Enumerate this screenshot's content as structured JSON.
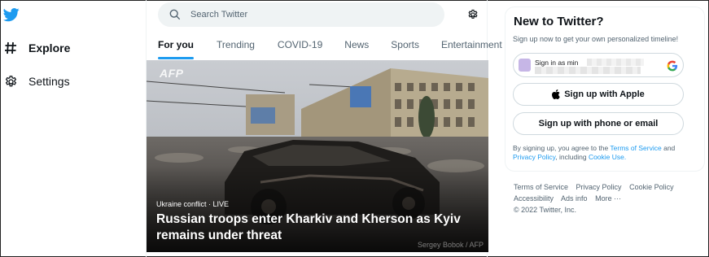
{
  "colors": {
    "brand": "#1d9bf0",
    "text": "#0f1419",
    "muted": "#536471"
  },
  "nav": {
    "logo_icon": "twitter-bird-icon",
    "items": [
      {
        "label": "Explore",
        "icon": "hashtag-icon"
      },
      {
        "label": "Settings",
        "icon": "gear-icon"
      }
    ]
  },
  "search": {
    "placeholder": "Search Twitter",
    "value": ""
  },
  "tabs": [
    "For you",
    "Trending",
    "COVID-19",
    "News",
    "Sports",
    "Entertainment"
  ],
  "hero": {
    "watermark": "AFP",
    "credit": "Sergey Bobok / AFP",
    "kicker": "Ukraine conflict · LIVE",
    "headline": "Russian troops enter Kharkiv and Kherson as Kyiv remains under threat"
  },
  "signup": {
    "title": "New to Twitter?",
    "subtitle": "Sign up now to get your own personalized timeline!",
    "google_label": "Sign in as min",
    "apple_label": "Sign up with Apple",
    "phone_label": "Sign up with phone or email",
    "terms_prefix": "By signing up, you agree to the",
    "terms_link": "Terms of Service",
    "terms_and": "and",
    "privacy_link": "Privacy Policy",
    "terms_including": ", including",
    "cookie_link": "Cookie Use."
  },
  "footer": {
    "links_row1": [
      "Terms of Service",
      "Privacy Policy",
      "Cookie Policy"
    ],
    "links_row2": [
      "Accessibility",
      "Ads info",
      "More ···"
    ],
    "copyright": "© 2022 Twitter, Inc."
  }
}
